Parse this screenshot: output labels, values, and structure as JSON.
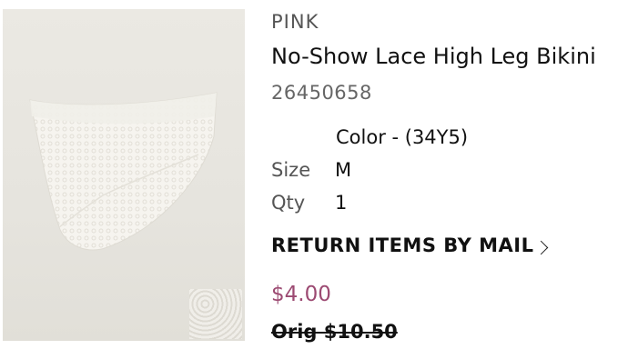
{
  "product": {
    "brand": "PINK",
    "title": "No-Show Lace High Leg Bikini",
    "sku": "26450658",
    "color_label": "Color - (34Y5)",
    "size_label": "Size",
    "size_value": "M",
    "qty_label": "Qty",
    "qty_value": "1",
    "return_link": "RETURN ITEMS BY MAIL",
    "price": "$4.00",
    "original_price": "Orig $10.50",
    "price_color": "#9c4a72"
  }
}
